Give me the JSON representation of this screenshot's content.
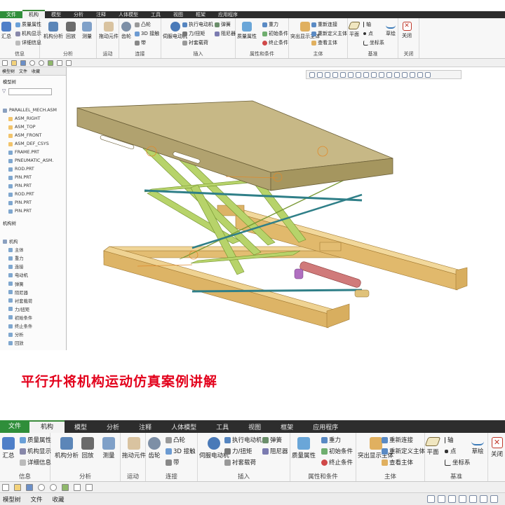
{
  "ribbon": {
    "tabs": [
      "文件",
      "机构",
      "模型",
      "分析",
      "注释",
      "人体模型",
      "工具",
      "视图",
      "框架",
      "应用程序"
    ],
    "active_tab": "机构",
    "groups": {
      "info": {
        "label": "信息",
        "summary": "汇总",
        "mass_props": "质量属性",
        "mech_display": "机构显示",
        "detail_info": "详细信息"
      },
      "analysis": {
        "label": "分析",
        "mech_analysis": "机构分析",
        "playback": "回放",
        "measure": "测量"
      },
      "motion": {
        "label": "运动",
        "drag": "拖动元件"
      },
      "connect": {
        "label": "连接",
        "gear": "齿轮",
        "cam": "凸轮",
        "joint3d": "3D 接触",
        "belt": "带"
      },
      "insert": {
        "label": "插入",
        "servo": "伺服电动机",
        "actuator": "执行电动机",
        "force": "力/扭矩",
        "bushing": "衬套载荷",
        "spring": "弹簧",
        "damper": "阻尼器"
      },
      "props": {
        "label": "属性和条件",
        "mass": "质量属性",
        "gravity": "重力",
        "init_cond": "初始条件",
        "term_cond": "终止条件"
      },
      "body": {
        "label": "主体",
        "highlight": "突出显示主体",
        "reconnect": "重新连接",
        "redefine": "重新定义主体",
        "view_body": "查看主体"
      },
      "datum": {
        "label": "基准",
        "plane": "平面",
        "axis": "轴",
        "point": "点",
        "csys": "坐标系",
        "sketch": "草绘"
      },
      "close": {
        "label": "关闭",
        "close": "关闭"
      }
    }
  },
  "panel": {
    "tabs": [
      "模型树",
      "文件",
      "收藏"
    ],
    "model_tree_label": "模型树",
    "model_tree": [
      "PARALLEL_MECH.ASM",
      "ASM_RIGHT",
      "ASM_TOP",
      "ASM_FRONT",
      "ASM_DEF_CSYS",
      "FRAME.PRT",
      "PNEUMATIC_ASM.",
      "ROD.PRT",
      "PIN.PRT",
      "PIN.PRT",
      "ROD.PRT",
      "PIN.PRT",
      "PIN.PRT"
    ],
    "mech_tree_label": "机构树",
    "mech_tree": [
      "机构",
      "主体",
      "重力",
      "连接",
      "电动机",
      "弹簧",
      "阻尼器",
      "衬套载荷",
      "力/扭矩",
      "初始条件",
      "终止条件",
      "分析",
      "回放"
    ]
  },
  "caption": "平行升将机构运动仿真案例讲解",
  "colors": {
    "tab_bar": "#2d2d2d",
    "file_tab": "#2f8e3a",
    "tabletop": "#c7b886",
    "frame": "#e3bd72",
    "scissor": "#b7d36a",
    "rod": "#2f7f88",
    "cylinder": "#d07a7a",
    "caption": "#e3001b"
  }
}
